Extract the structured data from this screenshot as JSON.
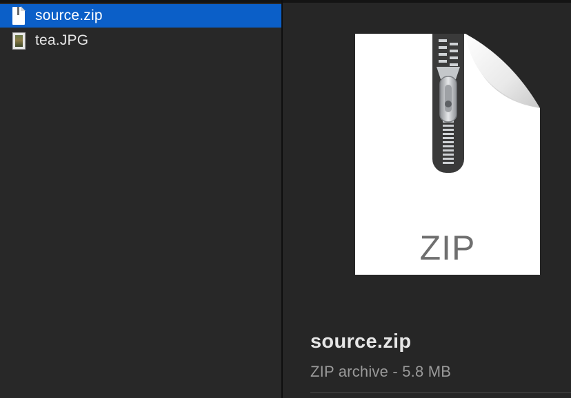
{
  "files": [
    {
      "name": "source.zip",
      "icon": "zip-file-icon",
      "selected": true
    },
    {
      "name": "tea.JPG",
      "icon": "jpg-file-icon",
      "selected": false
    }
  ],
  "preview": {
    "icon": "zip-archive-icon",
    "icon_label": "ZIP",
    "file_name": "source.zip",
    "file_info": "ZIP archive - 5.8 MB"
  },
  "colors": {
    "selection": "#0b5fc8",
    "background": "#282828"
  }
}
